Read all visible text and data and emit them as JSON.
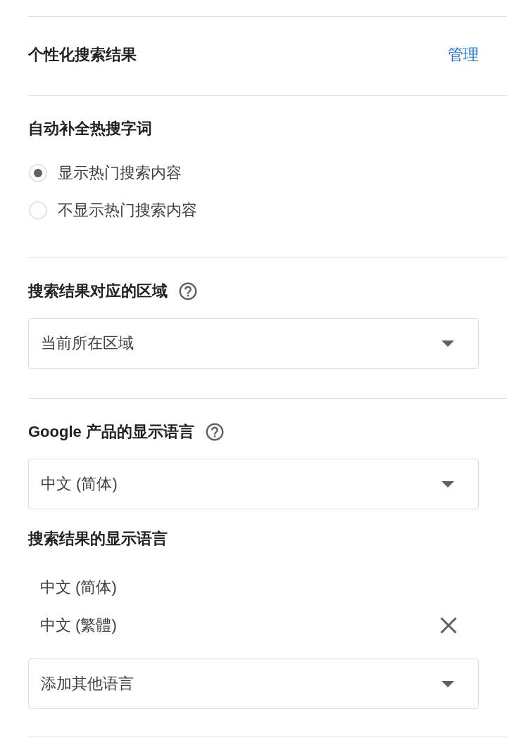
{
  "sections": [
    {
      "blocks": [
        {
          "kind": "link_row",
          "title": "个性化搜索结果",
          "link": "管理"
        }
      ]
    },
    {
      "blocks": [
        {
          "kind": "radio_group",
          "title": "自动补全热搜字词",
          "options": [
            {
              "label": "显示热门搜索内容",
              "selected": true
            },
            {
              "label": "不显示热门搜索内容",
              "selected": false
            }
          ]
        }
      ]
    },
    {
      "blocks": [
        {
          "kind": "dropdown",
          "title": "搜索结果对应的区域",
          "help": true,
          "value": "当前所在区域"
        }
      ]
    },
    {
      "blocks": [
        {
          "kind": "dropdown",
          "title": "Google 产品的显示语言",
          "help": true,
          "value": "中文 (简体)"
        },
        {
          "kind": "language_list",
          "title": "搜索结果的显示语言",
          "languages": [
            {
              "label": "中文 (简体)",
              "removable": false
            },
            {
              "label": "中文 (繁體)",
              "removable": true
            }
          ],
          "add_dropdown": {
            "value": "添加其他语言"
          }
        }
      ]
    }
  ]
}
